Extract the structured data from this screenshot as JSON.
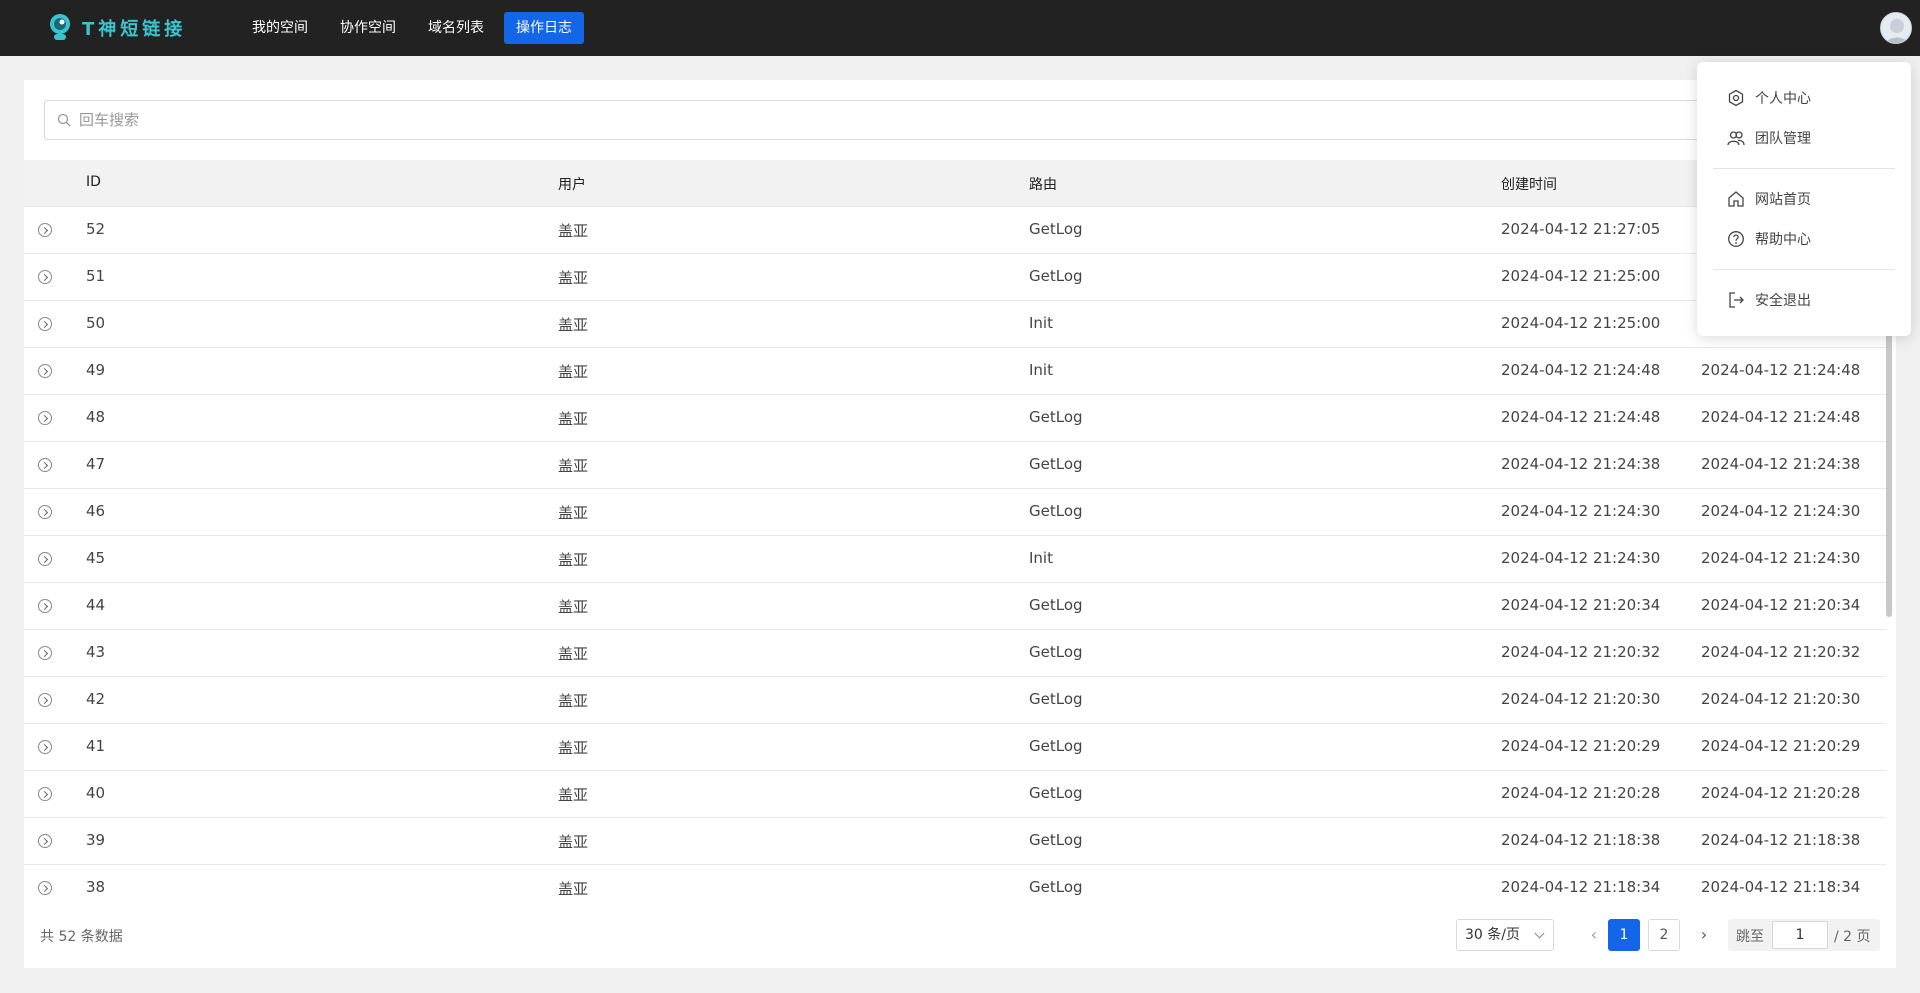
{
  "app": {
    "brand": "T神短链接"
  },
  "nav": {
    "items": [
      {
        "label": "我的空间"
      },
      {
        "label": "协作空间"
      },
      {
        "label": "域名列表"
      },
      {
        "label": "操作日志"
      }
    ]
  },
  "search": {
    "placeholder": "回车搜索"
  },
  "table": {
    "columns": {
      "id": "ID",
      "user": "用户",
      "route": "路由",
      "created": "创建时间"
    },
    "rows": [
      {
        "id": "52",
        "user": "盖亚",
        "route": "GetLog",
        "created": "2024-04-12 21:27:05",
        "updated": ""
      },
      {
        "id": "51",
        "user": "盖亚",
        "route": "GetLog",
        "created": "2024-04-12 21:25:00",
        "updated": ""
      },
      {
        "id": "50",
        "user": "盖亚",
        "route": "Init",
        "created": "2024-04-12 21:25:00",
        "updated": ""
      },
      {
        "id": "49",
        "user": "盖亚",
        "route": "Init",
        "created": "2024-04-12 21:24:48",
        "updated": "2024-04-12 21:24:48"
      },
      {
        "id": "48",
        "user": "盖亚",
        "route": "GetLog",
        "created": "2024-04-12 21:24:48",
        "updated": "2024-04-12 21:24:48"
      },
      {
        "id": "47",
        "user": "盖亚",
        "route": "GetLog",
        "created": "2024-04-12 21:24:38",
        "updated": "2024-04-12 21:24:38"
      },
      {
        "id": "46",
        "user": "盖亚",
        "route": "GetLog",
        "created": "2024-04-12 21:24:30",
        "updated": "2024-04-12 21:24:30"
      },
      {
        "id": "45",
        "user": "盖亚",
        "route": "Init",
        "created": "2024-04-12 21:24:30",
        "updated": "2024-04-12 21:24:30"
      },
      {
        "id": "44",
        "user": "盖亚",
        "route": "GetLog",
        "created": "2024-04-12 21:20:34",
        "updated": "2024-04-12 21:20:34"
      },
      {
        "id": "43",
        "user": "盖亚",
        "route": "GetLog",
        "created": "2024-04-12 21:20:32",
        "updated": "2024-04-12 21:20:32"
      },
      {
        "id": "42",
        "user": "盖亚",
        "route": "GetLog",
        "created": "2024-04-12 21:20:30",
        "updated": "2024-04-12 21:20:30"
      },
      {
        "id": "41",
        "user": "盖亚",
        "route": "GetLog",
        "created": "2024-04-12 21:20:29",
        "updated": "2024-04-12 21:20:29"
      },
      {
        "id": "40",
        "user": "盖亚",
        "route": "GetLog",
        "created": "2024-04-12 21:20:28",
        "updated": "2024-04-12 21:20:28"
      },
      {
        "id": "39",
        "user": "盖亚",
        "route": "GetLog",
        "created": "2024-04-12 21:18:38",
        "updated": "2024-04-12 21:18:38"
      },
      {
        "id": "38",
        "user": "盖亚",
        "route": "GetLog",
        "created": "2024-04-12 21:18:34",
        "updated": "2024-04-12 21:18:34"
      }
    ]
  },
  "footer": {
    "total": "共 52 条数据",
    "page_size": "30 条/页",
    "pages": [
      "1",
      "2"
    ],
    "current_page": "1",
    "jump_label": "跳至",
    "jump_value": "1",
    "jump_suffix": "/ 2 页"
  },
  "user_menu": {
    "items": [
      {
        "label": "个人中心",
        "icon": "settings-icon"
      },
      {
        "label": "团队管理",
        "icon": "team-icon"
      },
      {
        "label": "网站首页",
        "icon": "home-icon"
      },
      {
        "label": "帮助中心",
        "icon": "help-icon"
      },
      {
        "label": "安全退出",
        "icon": "logout-icon"
      }
    ]
  },
  "colors": {
    "topbar": "#222222",
    "primary": "#1366e8",
    "brand_text": "#3cc3d0"
  }
}
